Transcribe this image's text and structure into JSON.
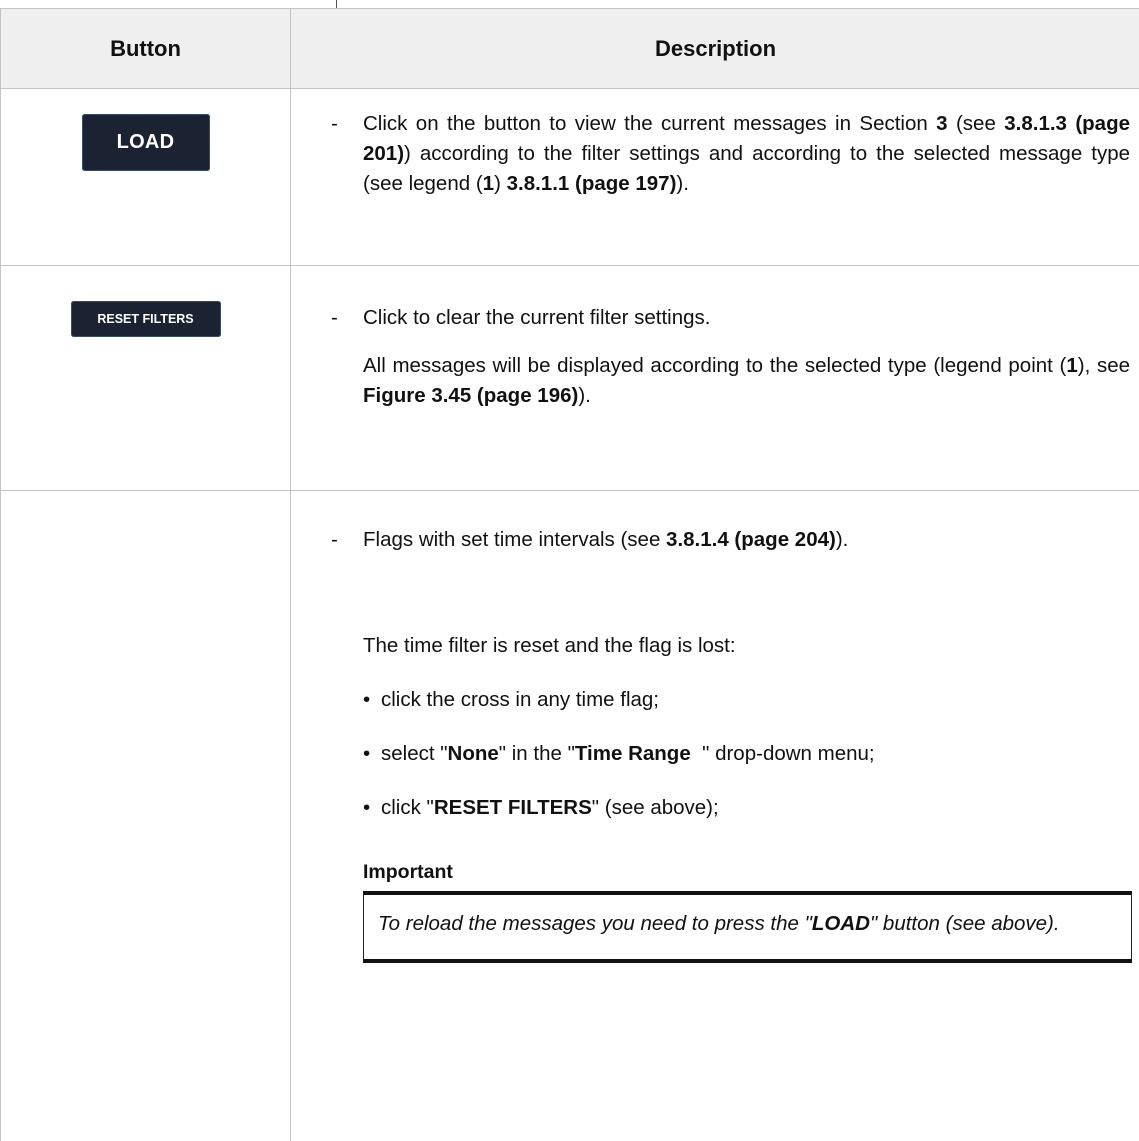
{
  "table": {
    "headers": {
      "button": "Button",
      "description": "Description"
    },
    "rows": [
      {
        "button_label": "LOAD",
        "desc": {
          "p1_a": "Click on the button to view the current messages in Section ",
          "p1_b": "3",
          "p1_c": " (see ",
          "p1_d": "3.8.1.3 (page 201)",
          "p1_e": ") according to the filter settings and according to the selected message type (see legend (",
          "p1_f": "1",
          "p1_g": ") ",
          "p1_h": "3.8.1.1 (page 197)",
          "p1_i": ")."
        }
      },
      {
        "button_label": "RESET FILTERS",
        "desc": {
          "p1": "Click to clear the current filter settings.",
          "p2_a": "All messages will be displayed according to the selected type (legend point (",
          "p2_b": "1",
          "p2_c": "), see ",
          "p2_d": "Figure 3.45 (page 196)",
          "p2_e": ")."
        }
      },
      {
        "desc": {
          "p1_a": "Flags with set time intervals (see ",
          "p1_b": "3.8.1.4 (page 204)",
          "p1_c": ").",
          "p2": "The time filter is reset and the flag is lost:",
          "bullet_char": "•",
          "b1": "click the cross in any time flag;",
          "b2_a": "select \"",
          "b2_b": "None",
          "b2_c": "\" in the \"",
          "b2_d": "Time Range  ",
          "b2_e": "\" drop-down menu;",
          "b3_a": "click \"",
          "b3_b": "RESET FILTERS",
          "b3_c": "\" (see above);",
          "important_title": "Important",
          "important_a": "To reload the messages you need to press the \"",
          "important_b": "LOAD",
          "important_c": "\" button (see above)."
        }
      }
    ],
    "dash": "-"
  }
}
